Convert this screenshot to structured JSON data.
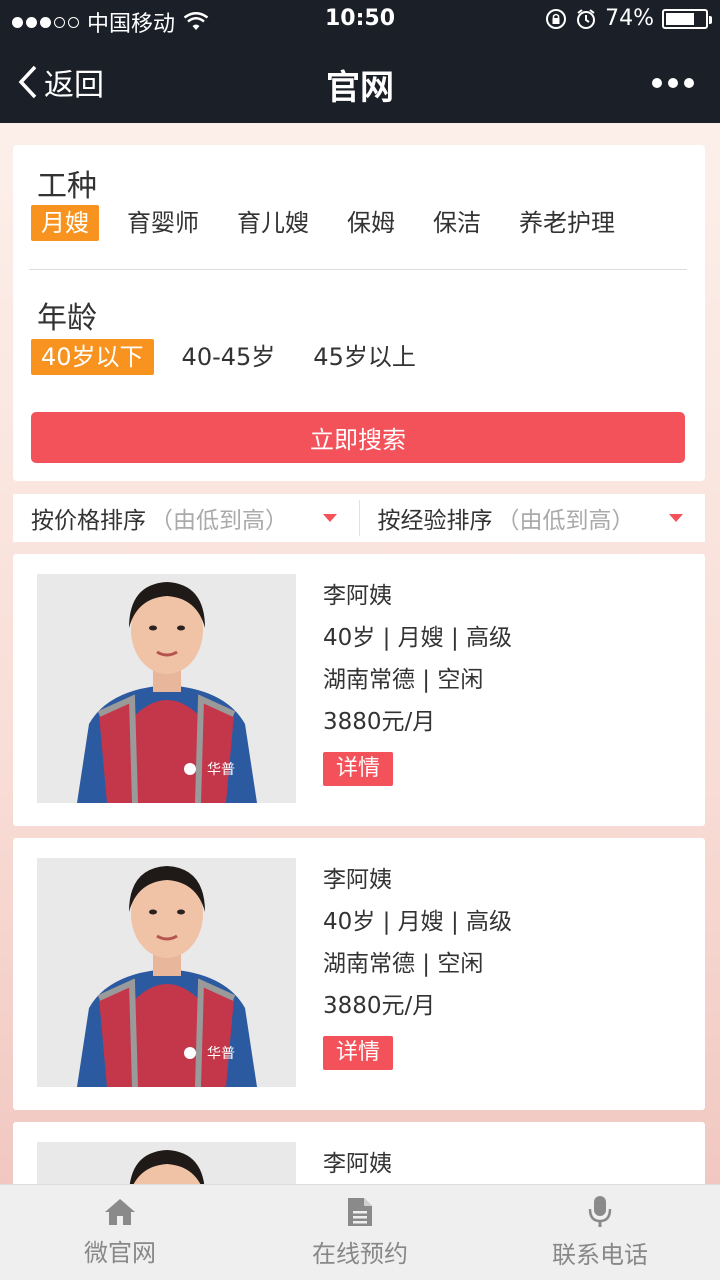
{
  "status_bar": {
    "carrier": "中国移动",
    "time": "10:50",
    "battery": "74%",
    "battery_level": 0.74
  },
  "nav": {
    "back_label": "返回",
    "title": "官网"
  },
  "filters": {
    "job_type": {
      "title": "工种",
      "options": [
        "月嫂",
        "育婴师",
        "育儿嫂",
        "保姆",
        "保洁",
        "养老护理"
      ],
      "selected_index": 0
    },
    "age": {
      "title": "年龄",
      "options": [
        "40岁以下",
        "40-45岁",
        "45岁以上"
      ],
      "selected_index": 0
    },
    "search_button": "立即搜索"
  },
  "sort": {
    "price_label": "按价格排序",
    "price_sub": "（由低到高）",
    "experience_label": "按经验排序",
    "experience_sub": "（由低到高）"
  },
  "listings": [
    {
      "name": "李阿姨",
      "line1": "40岁 | 月嫂 | 高级",
      "line2": "湖南常德 | 空闲",
      "price": "3880元/月",
      "detail_label": "详情",
      "apron_text": "华普"
    },
    {
      "name": "李阿姨",
      "line1": "40岁 | 月嫂 | 高级",
      "line2": "湖南常德 | 空闲",
      "price": "3880元/月",
      "detail_label": "详情",
      "apron_text": "华普"
    },
    {
      "name": "李阿姨"
    }
  ],
  "tabbar": {
    "tabs": [
      {
        "label": "微官网",
        "icon": "home-icon"
      },
      {
        "label": "在线预约",
        "icon": "document-icon"
      },
      {
        "label": "联系电话",
        "icon": "microphone-icon"
      }
    ]
  },
  "colors": {
    "accent_red": "#f3525b",
    "active_orange": "#f7931e",
    "header_dark": "#1b1f28"
  }
}
